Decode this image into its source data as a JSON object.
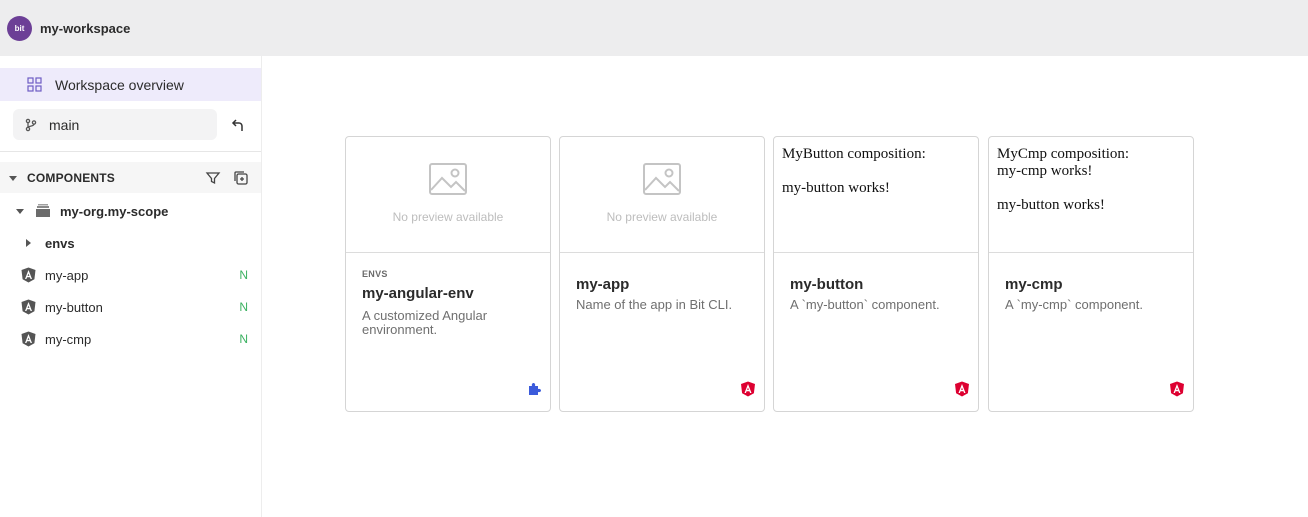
{
  "topbar": {
    "logo_text": "bit",
    "workspace_name": "my-workspace"
  },
  "sidebar": {
    "overview_label": "Workspace overview",
    "lane_label": "main",
    "components_header": "COMPONENTS",
    "scope": {
      "name": "my-org.my-scope"
    },
    "tree": [
      {
        "label": "envs",
        "type": "folder"
      },
      {
        "label": "my-app",
        "status": "N",
        "icon": "angular-icon"
      },
      {
        "label": "my-button",
        "status": "N",
        "icon": "angular-icon"
      },
      {
        "label": "my-cmp",
        "status": "N",
        "icon": "angular-icon"
      }
    ]
  },
  "cards": [
    {
      "preview_text": "No preview available",
      "tag": "ENVS",
      "title": "my-angular-env",
      "description": "A customized Angular environment.",
      "badge_icon": "env-puzzle-icon"
    },
    {
      "preview_text": "No preview available",
      "title": "my-app",
      "description": "Name of the app in Bit CLI.",
      "badge_icon": "angular-icon"
    },
    {
      "preview_lines": [
        "MyButton composition:",
        "",
        "my-button works!"
      ],
      "title": "my-button",
      "description": "A `my-button` component.",
      "badge_icon": "angular-icon"
    },
    {
      "preview_lines": [
        "MyCmp composition:",
        "my-cmp works!",
        "",
        "my-button works!"
      ],
      "title": "my-cmp",
      "description": "A `my-cmp` component.",
      "badge_icon": "angular-icon"
    }
  ],
  "colors": {
    "brand": "#6c3f96",
    "selected_bg": "#eeebfb",
    "new_status": "#3cb262",
    "angular_red": "#dd0031",
    "env_blue": "#3b5bdb"
  }
}
